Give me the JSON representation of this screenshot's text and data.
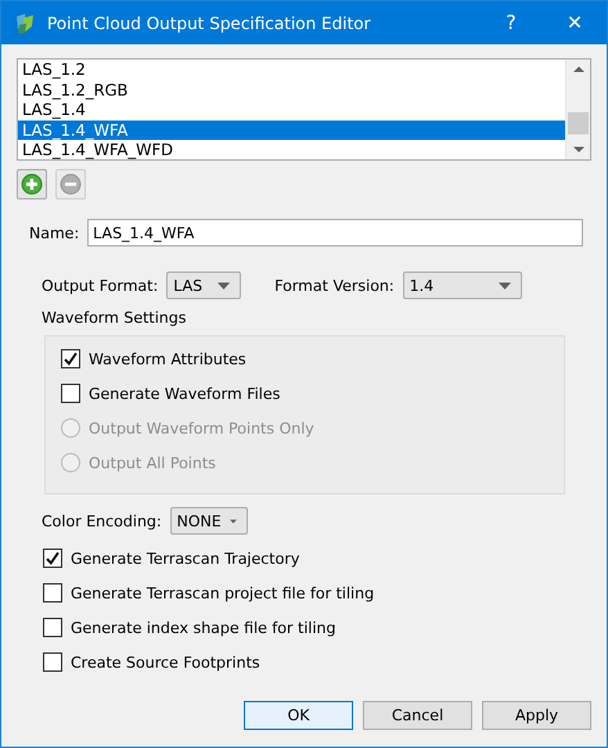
{
  "window": {
    "title": "Point Cloud Output Specification Editor",
    "help": "?",
    "close": "✕"
  },
  "spec_list": {
    "items": [
      {
        "label": "LAS_1.2",
        "selected": false
      },
      {
        "label": "LAS_1.2_RGB",
        "selected": false
      },
      {
        "label": "LAS_1.4",
        "selected": false
      },
      {
        "label": "LAS_1.4_WFA",
        "selected": true
      },
      {
        "label": "LAS_1.4_WFA_WFD",
        "selected": false
      }
    ]
  },
  "list_buttons": [
    {
      "kind": "add",
      "disabled": false
    },
    {
      "kind": "remove",
      "disabled": true
    }
  ],
  "name": {
    "label": "Name:",
    "value": "LAS_1.4_WFA"
  },
  "output_format": {
    "label": "Output Format:",
    "value": "LAS"
  },
  "format_version": {
    "label": "Format Version:",
    "value": "1.4"
  },
  "waveform_settings": {
    "title": "Waveform Settings",
    "options": [
      {
        "kind": "checkbox",
        "label": "Waveform Attributes",
        "checked": true,
        "disabled": false
      },
      {
        "kind": "checkbox",
        "label": "Generate Waveform Files",
        "checked": false,
        "disabled": false
      },
      {
        "kind": "radio",
        "label": "Output Waveform Points Only",
        "selected": false,
        "disabled": true
      },
      {
        "kind": "radio",
        "label": "Output All Points",
        "selected": false,
        "disabled": true
      }
    ]
  },
  "color_encoding": {
    "label": "Color Encoding:",
    "value": "NONE"
  },
  "options": [
    {
      "label": "Generate Terrascan Trajectory",
      "checked": true
    },
    {
      "label": "Generate Terrascan project file for tiling",
      "checked": false
    },
    {
      "label": "Generate index shape file for tiling",
      "checked": false
    },
    {
      "label": "Create Source Footprints",
      "checked": false
    }
  ],
  "buttons": [
    {
      "label": "OK",
      "default": true
    },
    {
      "label": "Cancel",
      "default": false
    },
    {
      "label": "Apply",
      "default": false
    }
  ]
}
